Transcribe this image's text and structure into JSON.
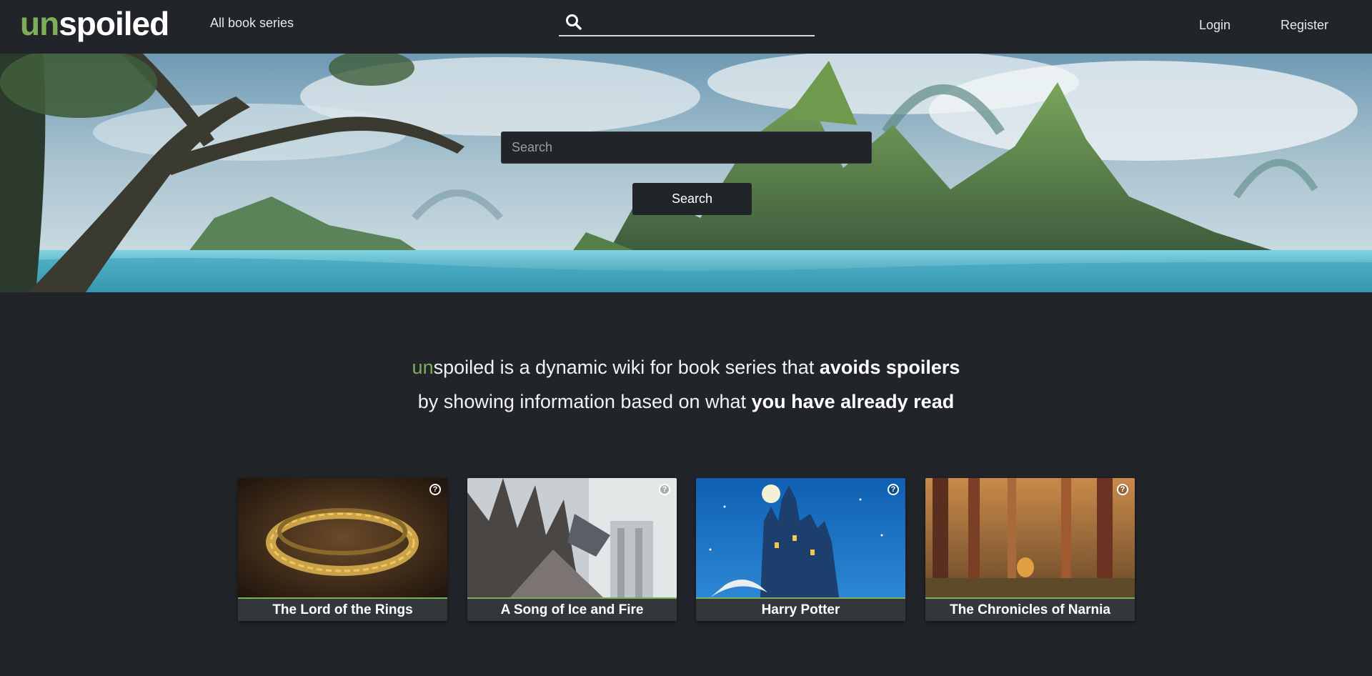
{
  "nav": {
    "logo_un": "un",
    "logo_rest": "spoiled",
    "all_series": "All book series",
    "search_value": "",
    "login": "Login",
    "register": "Register"
  },
  "hero": {
    "search_placeholder": "Search",
    "search_button": "Search"
  },
  "tagline": {
    "un": "un",
    "part1": "spoiled is a dynamic wiki for book series that ",
    "bold1": "avoids spoilers",
    "part2": "by showing information based on what ",
    "bold2": "you have already read"
  },
  "series": [
    {
      "title": "The Lord of the Rings"
    },
    {
      "title": "A Song of Ice and Fire"
    },
    {
      "title": "Harry Potter"
    },
    {
      "title": "The Chronicles of Narnia"
    }
  ],
  "help_glyph": "?",
  "colors": {
    "background": "#212428",
    "accent": "#7fae5a",
    "card_title_bg": "#33373c"
  },
  "icons": {
    "nav_search": "search-icon",
    "card_help": "help-icon"
  }
}
